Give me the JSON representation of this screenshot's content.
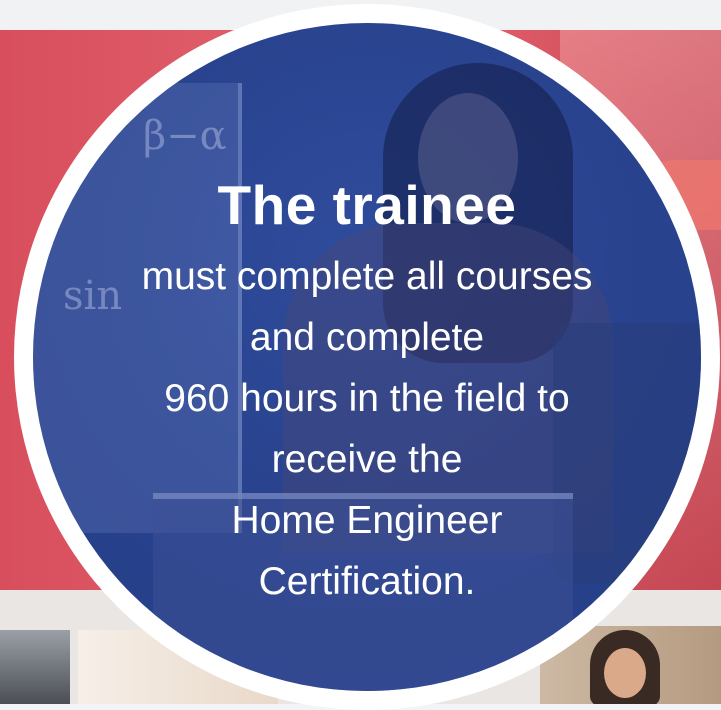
{
  "hero": {
    "title": "The trainee",
    "body_lines": [
      "must complete all courses",
      "and complete",
      "960 hours in the field to",
      "receive the",
      "Home Engineer",
      "Certification."
    ]
  },
  "colors": {
    "band": "#dd5a66",
    "circle": "#29438f",
    "ring": "#ffffff",
    "text": "#ffffff"
  }
}
